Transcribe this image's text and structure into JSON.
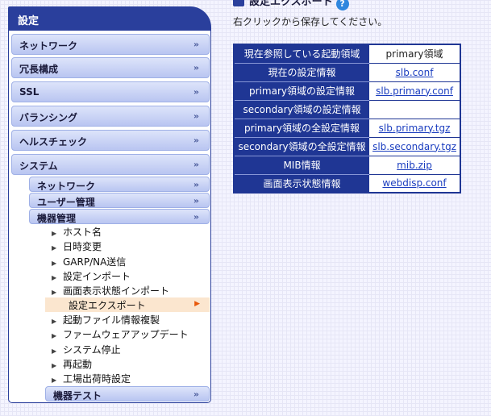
{
  "sidebar": {
    "title": "設定",
    "chevron": "»",
    "items": [
      {
        "label": "ネットワーク"
      },
      {
        "label": "冗長構成"
      },
      {
        "label": "SSL"
      },
      {
        "label": "バランシング"
      },
      {
        "label": "ヘルスチェック"
      },
      {
        "label": "システム"
      }
    ],
    "system_sub": [
      {
        "label": "ネットワーク"
      },
      {
        "label": "ユーザー管理"
      },
      {
        "label": "機器管理"
      }
    ],
    "device_leaves": [
      {
        "label": "ホスト名"
      },
      {
        "label": "日時変更"
      },
      {
        "label": "GARP/NA送信"
      },
      {
        "label": "設定インポート"
      },
      {
        "label": "画面表示状態インポート"
      }
    ],
    "active_leaf": {
      "label": "設定エクスポート"
    },
    "device_leaves_after": [
      {
        "label": "起動ファイル情報複製"
      },
      {
        "label": "ファームウェアアップデート"
      },
      {
        "label": "システム停止"
      },
      {
        "label": "再起動"
      },
      {
        "label": "工場出荷時設定"
      }
    ],
    "bottom_sub": {
      "label": "機器テスト"
    }
  },
  "main": {
    "title": "設定エクスポート",
    "help": "?",
    "subtitle": "右クリックから保存してください。",
    "rows": [
      {
        "label": "現在参照している起動領域",
        "value": "primary領域",
        "link": false
      },
      {
        "label": "現在の設定情報",
        "value": "slb.conf",
        "link": true
      },
      {
        "label": "primary領域の設定情報",
        "value": "slb.primary.conf",
        "link": true
      },
      {
        "label": "secondary領域の設定情報",
        "value": "",
        "link": false
      },
      {
        "label": "primary領域の全設定情報",
        "value": "slb.primary.tgz",
        "link": true
      },
      {
        "label": "secondary領域の全設定情報",
        "value": "slb.secondary.tgz",
        "link": true
      },
      {
        "label": "MIB情報",
        "value": "mib.zip",
        "link": true
      },
      {
        "label": "画面表示状態情報",
        "value": "webdisp.conf",
        "link": true
      }
    ]
  }
}
